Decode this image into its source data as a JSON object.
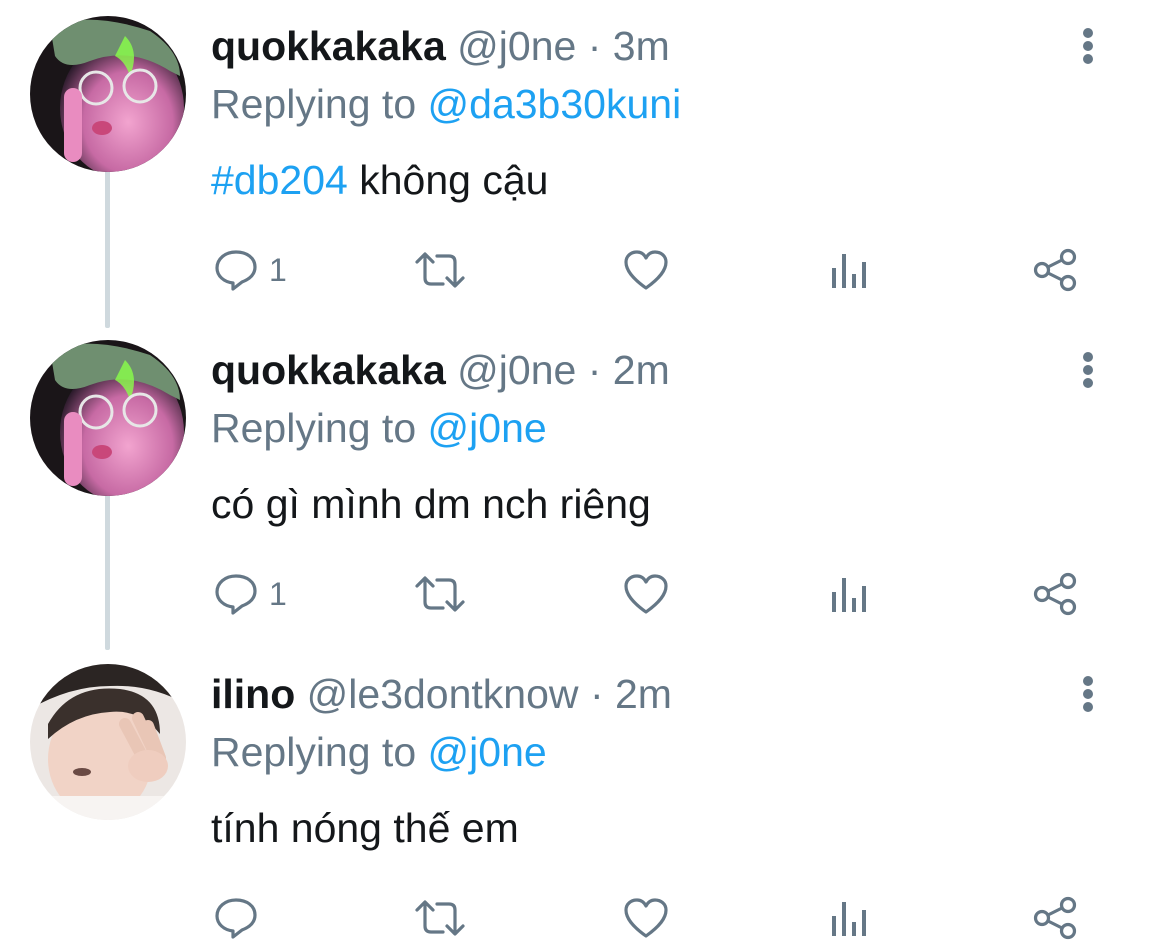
{
  "colors": {
    "text": "#14171a",
    "muted": "#657786",
    "accent": "#1da1f2",
    "thread_line": "#cfd9de"
  },
  "replying_prefix": "Replying to",
  "tweets": [
    {
      "name": "quokkakaka",
      "handle": "@j0ne",
      "dot": "·",
      "time": "3m",
      "replying_to": "@da3b30kuni",
      "hashtag": "#db204",
      "text": " không cậu",
      "reply_count": "1",
      "icons": [
        "reply-icon",
        "retweet-icon",
        "like-icon",
        "analytics-icon",
        "share-icon",
        "more-options-icon"
      ]
    },
    {
      "name": "quokkakaka",
      "handle": "@j0ne",
      "dot": "·",
      "time": "2m",
      "replying_to": "@j0ne",
      "text": "có gì mình dm nch riêng",
      "reply_count": "1",
      "icons": [
        "reply-icon",
        "retweet-icon",
        "like-icon",
        "analytics-icon",
        "share-icon",
        "more-options-icon"
      ]
    },
    {
      "name": "ilino",
      "handle": "@le3dontknow",
      "dot": "·",
      "time": "2m",
      "replying_to": "@j0ne",
      "text": "tính nóng thế em",
      "reply_count": "",
      "icons": [
        "reply-icon",
        "retweet-icon",
        "like-icon",
        "analytics-icon",
        "share-icon",
        "more-options-icon"
      ]
    }
  ]
}
